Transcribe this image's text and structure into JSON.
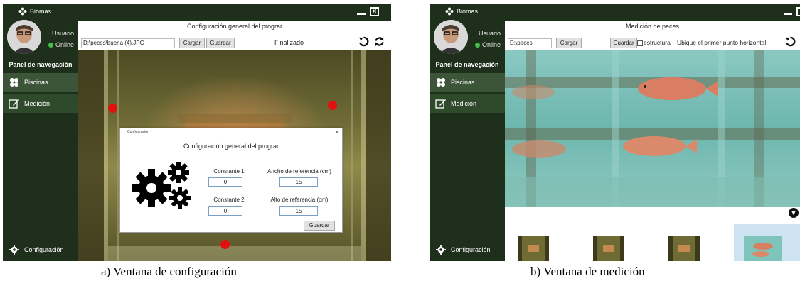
{
  "panel_a": {
    "brand": "Biomas",
    "user_name": "Usuario",
    "user_status": "Online",
    "nav_title": "Panel de navegación",
    "nav_items": [
      "Piscinas",
      "Medición"
    ],
    "config_label": "Configuración",
    "window_title": "Configuración general del prograr",
    "path_value": "D:\\peces\\buena (4).JPG",
    "load_label": "Cargar",
    "save_label": "Guardar",
    "status_text": "Finalizado",
    "dialog": {
      "title": "Configuración",
      "close": "×",
      "heading": "Configuración general del prograr",
      "const1_label": "Constante 1",
      "const1_value": "0",
      "width_label": "Ancho de referencia (cm)",
      "width_value": "15",
      "const2_label": "Constante 2",
      "const2_value": "0",
      "height_label": "Alto de referencia (cm)",
      "height_value": "15",
      "save_label": "Guardar"
    },
    "caption": "a) Ventana de configuración"
  },
  "panel_b": {
    "brand": "Biomas",
    "user_name": "Usuario",
    "user_status": "Online",
    "nav_title": "Panel de navegación",
    "nav_items": [
      "Piscinas",
      "Medición"
    ],
    "config_label": "Configuración",
    "window_title": "Medición de peces",
    "path_value": "D:\\peces",
    "load_label": "Cargar",
    "save_label": "Guardar",
    "checkbox_label": "estructura",
    "instruction": "Ubique el primer punto horizontal",
    "caption": "b) Ventana de medición"
  },
  "colors": {
    "sidebar": "#1e2f1b",
    "nav_selected": "#3c5438",
    "marker": "#e31010",
    "online": "#44c04a"
  }
}
